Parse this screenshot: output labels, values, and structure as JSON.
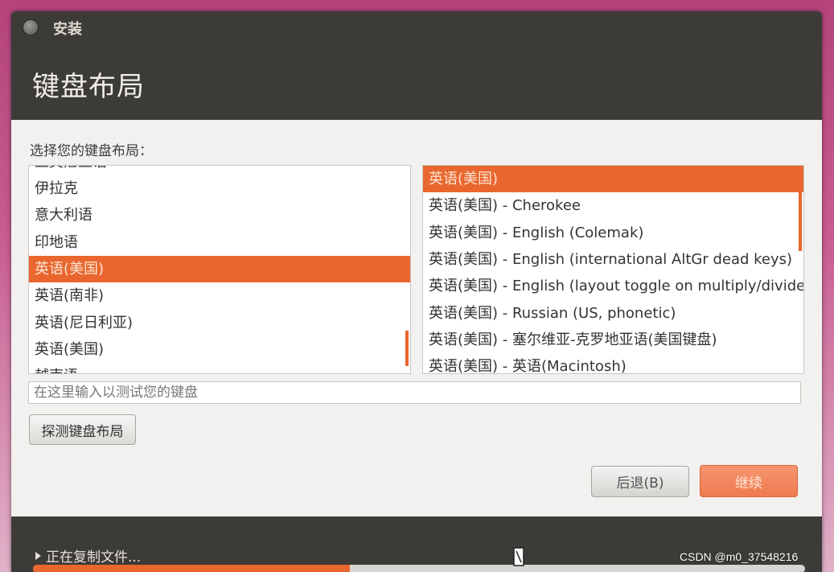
{
  "window": {
    "title": "安装",
    "page_title": "键盘布局"
  },
  "content": {
    "prompt": "选择您的键盘布局：",
    "left_list": {
      "partial_top": "亚美尼亚语",
      "items": [
        {
          "label": "伊拉克",
          "selected": false
        },
        {
          "label": "意大利语",
          "selected": false
        },
        {
          "label": "印地语",
          "selected": false
        },
        {
          "label": "英语(美国)",
          "selected": true
        },
        {
          "label": "英语(南非)",
          "selected": false
        },
        {
          "label": "英语(尼日利亚)",
          "selected": false
        },
        {
          "label": "英语(美国)",
          "selected": false
        }
      ],
      "partial_bottom": "越南语"
    },
    "right_list": {
      "items": [
        {
          "label": "英语(美国)",
          "selected": true
        },
        {
          "label": "英语(美国) - Cherokee",
          "selected": false
        },
        {
          "label": "英语(美国) - English (Colemak)",
          "selected": false
        },
        {
          "label": "英语(美国) - English (international AltGr dead keys)",
          "selected": false
        },
        {
          "label": "英语(美国) - English (layout toggle on multiply/divide key)",
          "selected": false
        },
        {
          "label": "英语(美国) - Russian (US, phonetic)",
          "selected": false
        },
        {
          "label": "英语(美国) - 塞尔维亚-克罗地亚语(美国键盘)",
          "selected": false
        }
      ],
      "partial_bottom": "英语(美国) - 英语(Macintosh)"
    },
    "test_input_placeholder": "在这里输入以测试您的键盘",
    "detect_button": "探测键盘布局",
    "back_button": "后退(B)",
    "continue_button": "继续"
  },
  "footer": {
    "status": "正在复制文件...",
    "progress": 0.41
  },
  "watermark": "CSDN @m0_37548216",
  "colors": {
    "accent": "#e9672e",
    "dark_chrome": "#3c3b37",
    "content_bg": "#f2f1f0"
  }
}
